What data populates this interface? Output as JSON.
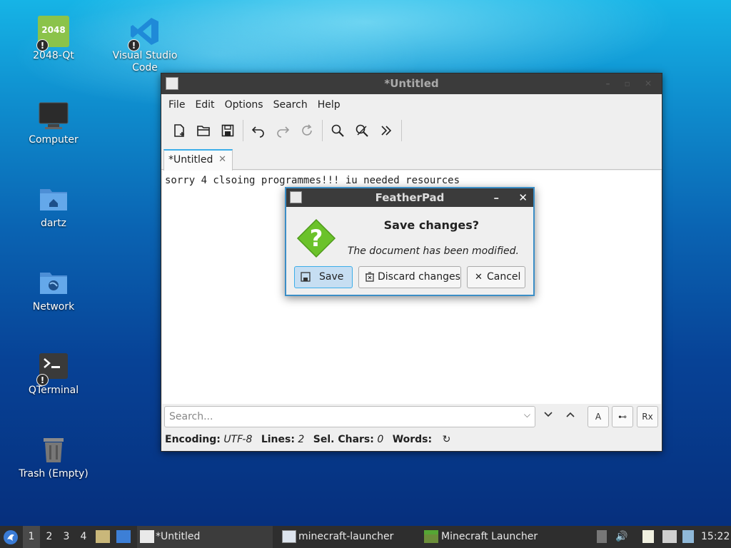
{
  "desktop": {
    "icons": [
      {
        "label": "2048-Qt",
        "icon_text": "2048"
      },
      {
        "label": "Visual Studio Code"
      },
      {
        "label": "Computer"
      },
      {
        "label": "dartz"
      },
      {
        "label": "Network"
      },
      {
        "label": "QTerminal"
      },
      {
        "label": "Trash (Empty)"
      }
    ],
    "warn_mark": "!"
  },
  "window": {
    "title": "*Untitled",
    "menu": [
      "File",
      "Edit",
      "Options",
      "Search",
      "Help"
    ],
    "tab_label": "*Untitled",
    "tab_close": "✕",
    "editor_text": "sorry 4  clsoing programmes!!! iu needed resources",
    "search_placeholder": "Search...",
    "search_toggles": [
      "A",
      "⊷",
      "Rx"
    ],
    "status": {
      "encoding_label": "Encoding:",
      "encoding": "UTF-8",
      "lines_label": "Lines:",
      "lines": "2",
      "selchars_label": "Sel. Chars:",
      "selchars": "0",
      "words_label": "Words:"
    }
  },
  "dialog": {
    "title": "FeatherPad",
    "heading": "Save changes?",
    "message": "The document has been modified.",
    "buttons": {
      "save": "Save",
      "discard": "Discard changes",
      "cancel": "Cancel"
    },
    "min_glyph": "–",
    "close_glyph": "✕"
  },
  "taskbar": {
    "workspaces": [
      "1",
      "2",
      "3",
      "4"
    ],
    "tasks": [
      "*Untitled",
      "minecraft-launcher",
      "Minecraft Launcher"
    ],
    "clock": "15:22"
  },
  "colors": {
    "accent": "#3daee9",
    "taskbar": "#2e2e2e",
    "titlebar": "#3b3b3b"
  }
}
